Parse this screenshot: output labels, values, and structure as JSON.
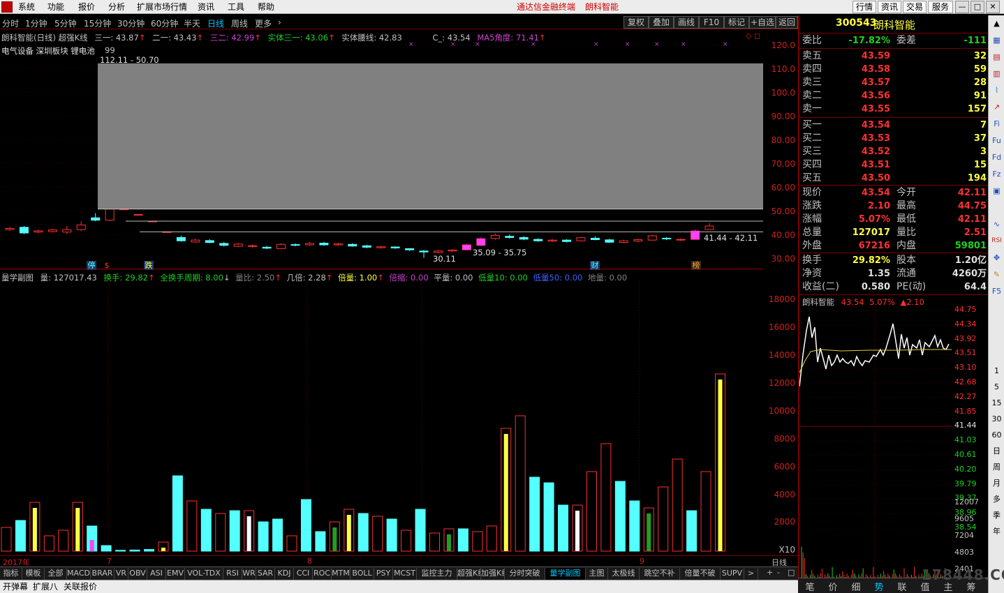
{
  "menu": {
    "items": [
      "系统",
      "功能",
      "报价",
      "分析",
      "扩展市场行情",
      "资讯",
      "工具",
      "帮助"
    ],
    "center_title": "通达信金融终端",
    "center_stock": "朗科智能",
    "right_buttons": [
      "行情",
      "资讯",
      "交易",
      "服务"
    ]
  },
  "periods": {
    "items": [
      "分时",
      "1分钟",
      "5分钟",
      "15分钟",
      "30分钟",
      "60分钟",
      "半天",
      "日线",
      "周线",
      "更多",
      "›"
    ],
    "active": "日线",
    "tools": [
      "复权",
      "叠加",
      "画线",
      "F10",
      "标记",
      "+自选",
      "返回"
    ]
  },
  "main_chart": {
    "title": "朗科智能(日线) 超强K线",
    "indicators": [
      {
        "label": "三一: 43.87",
        "color": "#c0c0c0"
      },
      {
        "label": "二一: 43.43",
        "color": "#c0c0c0"
      },
      {
        "label": "三二: 42.99",
        "color": "#d040d0"
      },
      {
        "label": "实体三一: 43.06",
        "color": "#20d020"
      },
      {
        "label": "实体腰线: 42.83",
        "color": "#c0c0c0"
      },
      {
        "label": "C_: 43.54",
        "color": "#c0c0c0"
      },
      {
        "label": "MA5角度: 71.41",
        "color": "#d040d0"
      }
    ],
    "sector_line": "电气设备  深圳板块  锂电池",
    "annotation_99": "99",
    "range_labels": {
      "top": "112.11 - 50.70",
      "mid": "35.09 - 35.75",
      "right": "41.44 - 42.11",
      "low": "30.11"
    },
    "event_markers": [
      "停",
      "$",
      "跌",
      "财",
      "榜"
    ]
  },
  "main_axis": [
    "120.0",
    "110.0",
    "100.0",
    "90.00",
    "80.00",
    "70.00",
    "60.00",
    "50.00",
    "40.00",
    "30.00"
  ],
  "vol_chart": {
    "title": "量学副图",
    "indicators": [
      {
        "label": "量: 127017.43",
        "color": "#c0c0c0"
      },
      {
        "label": "换手: 29.82",
        "color": "#20d020"
      },
      {
        "label": "全换手周期: 8.00",
        "color": "#20d020"
      },
      {
        "label": "量比: 2.50",
        "color": "#808080"
      },
      {
        "label": "几倍: 2.28",
        "color": "#c0c0c0"
      },
      {
        "label": "倍量: 1.00",
        "color": "#ffff40"
      },
      {
        "label": "倍缩: 0.00",
        "color": "#d040d0"
      },
      {
        "label": "平量: 0.00",
        "color": "#c0c0c0"
      },
      {
        "label": "低量10: 0.00",
        "color": "#20d020"
      },
      {
        "label": "低量50: 0.00",
        "color": "#4060ff"
      },
      {
        "label": "地量: 0.00",
        "color": "#808080"
      }
    ],
    "x10": "X10"
  },
  "vol_axis": [
    "18000",
    "16000",
    "14000",
    "12000",
    "10000",
    "8000",
    "6000",
    "4000",
    "2000"
  ],
  "dates": {
    "year": "2017年",
    "m7": "7",
    "m8": "8",
    "m9": "9",
    "period": "日线"
  },
  "index_tabs": [
    "指标",
    "模板",
    "全部",
    "MACD",
    "BRAR",
    "VR",
    "OBV",
    "ASI",
    "EMV",
    "VOL-TDX",
    "RSI",
    "WR",
    "SAR",
    "KDJ",
    "CCI",
    "ROC",
    "MTM",
    "BOLL",
    "PSY",
    "MCST",
    "监控主力",
    "超强K线",
    "加强K线",
    "分时突破",
    "量学副图",
    "主图",
    "太极线",
    "跳空不补",
    "倍量不破",
    "SUPV",
    ">"
  ],
  "index_tab_active": "量学副图",
  "bottom_tabs": [
    "开弹幕",
    "扩展八",
    "关联报价"
  ],
  "bottom_right": [
    "+",
    "-",
    "□"
  ],
  "quote": {
    "code": "300543",
    "name": "朗科智能",
    "weibi_label": "委比",
    "weibi": "-17.82%",
    "weicha_label": "委差",
    "weicha": "-111",
    "asks": [
      {
        "label": "卖五",
        "price": "43.59",
        "vol": "32"
      },
      {
        "label": "卖四",
        "price": "43.58",
        "vol": "59"
      },
      {
        "label": "卖三",
        "price": "43.57",
        "vol": "28"
      },
      {
        "label": "卖二",
        "price": "43.56",
        "vol": "91"
      },
      {
        "label": "卖一",
        "price": "43.55",
        "vol": "157"
      }
    ],
    "bids": [
      {
        "label": "买一",
        "price": "43.54",
        "vol": "7"
      },
      {
        "label": "买二",
        "price": "43.53",
        "vol": "37"
      },
      {
        "label": "买三",
        "price": "43.52",
        "vol": "3"
      },
      {
        "label": "买四",
        "price": "43.51",
        "vol": "15"
      },
      {
        "label": "买五",
        "price": "43.50",
        "vol": "194"
      }
    ],
    "stats1": [
      {
        "l1": "现价",
        "v1": "43.54",
        "c1": "#ff3030",
        "l2": "今开",
        "v2": "42.11",
        "c2": "#ff3030"
      },
      {
        "l1": "涨跌",
        "v1": "2.10",
        "c1": "#ff3030",
        "l2": "最高",
        "v2": "44.75",
        "c2": "#ff3030"
      },
      {
        "l1": "涨幅",
        "v1": "5.07%",
        "c1": "#ff3030",
        "l2": "最低",
        "v2": "42.11",
        "c2": "#ff3030"
      },
      {
        "l1": "总量",
        "v1": "127017",
        "c1": "#ffff40",
        "l2": "量比",
        "v2": "2.51",
        "c2": "#ff3030"
      },
      {
        "l1": "外盘",
        "v1": "67216",
        "c1": "#ff3030",
        "l2": "内盘",
        "v2": "59801",
        "c2": "#20d020"
      }
    ],
    "stats2": [
      {
        "l1": "换手",
        "v1": "29.82%",
        "c1": "#ffff40",
        "l2": "股本",
        "v2": "1.20亿",
        "c2": "#e0e0e0"
      },
      {
        "l1": "净资",
        "v1": "1.35",
        "c1": "#e0e0e0",
        "l2": "流通",
        "v2": "4260万",
        "c2": "#e0e0e0"
      },
      {
        "l1": "收益(二)",
        "v1": "0.580",
        "c1": "#e0e0e0",
        "l2": "PE(动)",
        "v2": "64.4",
        "c2": "#e0e0e0"
      }
    ]
  },
  "mini_chart": {
    "name": "朗科智能",
    "price": "43.54",
    "pct": "5.07%",
    "chg": "▲2.10",
    "price_axis": [
      "44.75",
      "44.34",
      "43.92",
      "43.51",
      "43.10",
      "42.68",
      "42.27",
      "41.85",
      "41.44",
      "41.03",
      "40.61",
      "40.20",
      "39.79",
      "39.37",
      "38.96",
      "38.54"
    ],
    "vol_axis": [
      "12007",
      "9605",
      "7204",
      "4803",
      "2401"
    ],
    "tabs": [
      "笔",
      "价",
      "细",
      "势",
      "联",
      "值",
      "主",
      "筹"
    ],
    "active_tab": "势"
  },
  "right_toolbar": [
    "1",
    "5",
    "15",
    "30",
    "60",
    "日",
    "周",
    "月",
    "多",
    "季",
    "年"
  ],
  "watermark": "178448.COM",
  "colors": {
    "up": "#ff3030",
    "down": "#54ffff",
    "grid": "#7a0000",
    "yellow": "#ffff40"
  },
  "chart_data": [
    {
      "type": "candlestick",
      "title": "朗科智能(日线) 超强K线",
      "candles": [
        {
          "o": 42.0,
          "c": 42.5,
          "h": 43.2,
          "l": 41.5
        },
        {
          "o": 43.0,
          "c": 40.6,
          "h": 43.5,
          "l": 40.2
        },
        {
          "o": 41.0,
          "c": 41.5,
          "h": 42.0,
          "l": 40.5
        },
        {
          "o": 41.2,
          "c": 41.9,
          "h": 42.3,
          "l": 40.8
        },
        {
          "o": 41.0,
          "c": 42.0,
          "h": 43.5,
          "l": 40.2
        },
        {
          "o": 42.0,
          "c": 44.0,
          "h": 45.5,
          "l": 41.5
        },
        {
          "o": 47.0,
          "c": 46.0,
          "h": 49.0,
          "l": 45.5
        },
        {
          "o": 46.0,
          "c": 50.7,
          "h": 112.11,
          "l": 45.5
        },
        {
          "o": 50.7,
          "c": 50.7,
          "h": 50.7,
          "l": 50.7
        },
        {
          "o": 48.4,
          "c": 48.4,
          "h": 48.4,
          "l": 48.4
        },
        {
          "o": 45.6,
          "c": 45.6,
          "h": 45.6,
          "l": 45.6
        },
        {
          "o": 41.1,
          "c": 41.1,
          "h": 41.1,
          "l": 41.1
        },
        {
          "o": 38.7,
          "c": 37.3,
          "h": 39.5,
          "l": 37.0
        },
        {
          "o": 36.8,
          "c": 37.6,
          "h": 38.2,
          "l": 36.4
        },
        {
          "o": 37.4,
          "c": 36.6,
          "h": 38.0,
          "l": 36.2
        },
        {
          "o": 36.2,
          "c": 35.4,
          "h": 36.8,
          "l": 34.9
        },
        {
          "o": 35.0,
          "c": 35.9,
          "h": 36.4,
          "l": 34.6
        },
        {
          "o": 35.0,
          "c": 35.2,
          "h": 35.8,
          "l": 34.5
        },
        {
          "o": 34.6,
          "c": 34.2,
          "h": 35.2,
          "l": 33.8
        },
        {
          "o": 34.0,
          "c": 35.8,
          "h": 36.3,
          "l": 33.8
        },
        {
          "o": 35.7,
          "c": 35.5,
          "h": 36.2,
          "l": 35.0
        },
        {
          "o": 35.6,
          "c": 36.2,
          "h": 36.8,
          "l": 35.2
        },
        {
          "o": 36.3,
          "c": 35.6,
          "h": 36.9,
          "l": 35.2
        },
        {
          "o": 35.6,
          "c": 36.0,
          "h": 36.5,
          "l": 35.1
        },
        {
          "o": 35.8,
          "c": 35.1,
          "h": 36.3,
          "l": 34.8
        },
        {
          "o": 35.2,
          "c": 34.6,
          "h": 35.6,
          "l": 34.2
        },
        {
          "o": 34.4,
          "c": 34.8,
          "h": 35.2,
          "l": 34.0
        },
        {
          "o": 34.7,
          "c": 34.3,
          "h": 35.0,
          "l": 33.9
        },
        {
          "o": 34.0,
          "c": 33.5,
          "h": 34.2,
          "l": 33.0
        },
        {
          "o": 33.0,
          "c": 32.6,
          "h": 33.4,
          "l": 30.11
        },
        {
          "o": 32.4,
          "c": 33.0,
          "h": 33.5,
          "l": 32.0
        },
        {
          "o": 33.0,
          "c": 33.4,
          "h": 33.8,
          "l": 32.6
        },
        {
          "o": 33.5,
          "c": 35.6,
          "h": 36.0,
          "l": 33.3
        },
        {
          "o": 35.4,
          "c": 38.2,
          "h": 38.8,
          "l": 35.09
        },
        {
          "o": 38.3,
          "c": 39.6,
          "h": 40.4,
          "l": 37.8
        },
        {
          "o": 39.2,
          "c": 38.7,
          "h": 40.0,
          "l": 38.2
        },
        {
          "o": 38.7,
          "c": 38.0,
          "h": 39.3,
          "l": 37.6
        },
        {
          "o": 37.9,
          "c": 37.3,
          "h": 38.4,
          "l": 36.9
        },
        {
          "o": 37.2,
          "c": 37.6,
          "h": 38.1,
          "l": 36.8
        },
        {
          "o": 37.6,
          "c": 37.0,
          "h": 38.0,
          "l": 36.6
        },
        {
          "o": 37.3,
          "c": 38.6,
          "h": 39.0,
          "l": 37.0
        },
        {
          "o": 38.4,
          "c": 37.8,
          "h": 39.2,
          "l": 37.5
        },
        {
          "o": 37.7,
          "c": 36.7,
          "h": 38.2,
          "l": 36.4
        },
        {
          "o": 36.6,
          "c": 37.3,
          "h": 37.8,
          "l": 36.2
        },
        {
          "o": 37.2,
          "c": 37.8,
          "h": 38.2,
          "l": 36.8
        },
        {
          "o": 37.6,
          "c": 39.4,
          "h": 39.9,
          "l": 37.3
        },
        {
          "o": 38.4,
          "c": 38.1,
          "h": 38.9,
          "l": 37.6
        },
        {
          "o": 37.6,
          "c": 37.9,
          "h": 38.3,
          "l": 37.2
        },
        {
          "o": 37.9,
          "c": 41.44,
          "h": 42.11,
          "l": 37.8
        },
        {
          "o": 42.11,
          "c": 43.54,
          "h": 44.75,
          "l": 42.11
        }
      ]
    },
    {
      "type": "bar",
      "title": "量学副图",
      "values": [
        1700,
        2200,
        3500,
        1100,
        1500,
        3500,
        1800,
        400,
        60,
        80,
        120,
        650,
        5400,
        3600,
        3000,
        2700,
        2900,
        2900,
        2100,
        2300,
        1100,
        3700,
        1400,
        2100,
        3000,
        2700,
        2500,
        2300,
        1500,
        3000,
        1300,
        1600,
        1600,
        1400,
        1800,
        8800,
        9700,
        5300,
        4900,
        3300,
        3300,
        5700,
        7700,
        5000,
        3600,
        3100,
        4600,
        6600,
        2900,
        5700,
        12700
      ],
      "flags": [
        "u",
        "d",
        "y",
        "u",
        "u",
        "y",
        "d",
        "d",
        "d",
        "d",
        "d",
        "y",
        "d",
        "u",
        "d",
        "u",
        "d",
        "w",
        "d",
        "d",
        "u",
        "d",
        "d",
        "g",
        "y",
        "d",
        "u",
        "d",
        "u",
        "d",
        "u",
        "g",
        "d",
        "u",
        "u",
        "y",
        "u",
        "d",
        "d",
        "d",
        "w",
        "u",
        "u",
        "d",
        "d",
        "g",
        "u",
        "u",
        "d",
        "u",
        "y"
      ],
      "ylim": [
        0,
        18000
      ]
    }
  ]
}
